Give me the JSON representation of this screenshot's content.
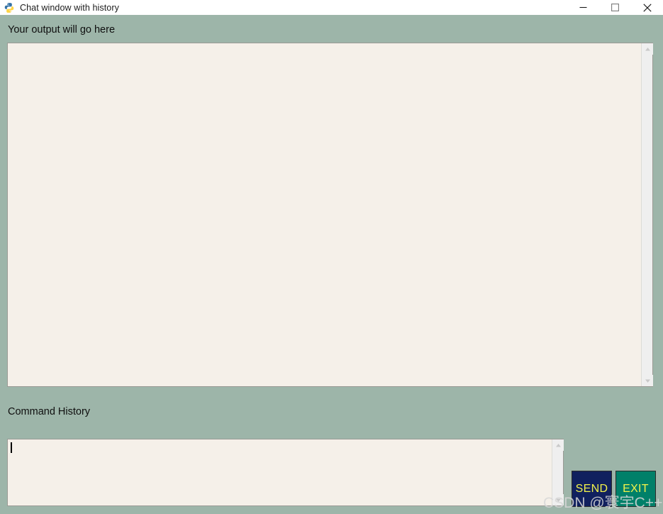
{
  "window": {
    "title": "Chat window with history",
    "icon": "python-logo-icon",
    "controls": {
      "minimize": "minimize-icon",
      "maximize": "maximize-icon",
      "close": "close-icon"
    }
  },
  "main": {
    "output_label": "Your output will go here",
    "output_value": "",
    "history_label": "Command History",
    "command_value": "",
    "scroll_up_icon": "chevron-up-icon",
    "scroll_down_icon": "chevron-down-icon"
  },
  "buttons": {
    "send_label": "SEND",
    "exit_label": "EXIT"
  },
  "watermark": {
    "text": "CSDN @寰宇C++"
  },
  "colors": {
    "background": "#9db5a9",
    "textarea": "#f5f0e9",
    "send_bg": "#10205e",
    "exit_bg": "#008069",
    "button_text": "#f2f24a",
    "titlebar": "#ffffff"
  }
}
